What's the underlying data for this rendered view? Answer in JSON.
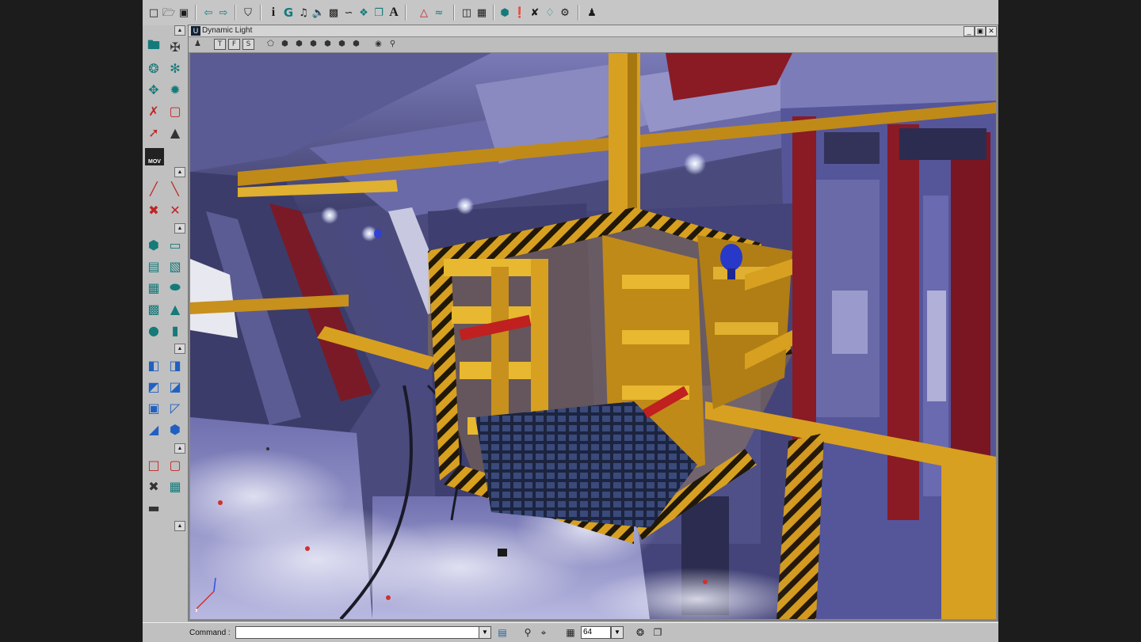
{
  "viewport": {
    "title": "Dynamic Light",
    "view_buttons": [
      "T",
      "F",
      "S"
    ]
  },
  "toolbar_glyphs": {
    "info": "i",
    "text": "A"
  },
  "status_bar": {
    "command_label": "Command :",
    "command_value": "",
    "grid_size": "64"
  },
  "icons": {
    "top": [
      "new-file-icon",
      "open-folder-icon",
      "save-icon",
      "undo-icon",
      "redo-icon",
      "search-icon",
      "info-icon",
      "group-icon",
      "music-icon",
      "sound-icon",
      "texture-icon",
      "mesh-icon",
      "actor-icon",
      "actor-class-icon",
      "text-icon",
      "triangle-icon",
      "terrain-icon",
      "matinee-icon",
      "prefab-icon",
      "light-icon",
      "path-icon",
      "emitter-icon",
      "props-icon",
      "play-level-icon"
    ],
    "left": [
      "camera-mode-icon",
      "move-icon",
      "rotate-icon",
      "scale-icon",
      "brush-move-icon",
      "vertex-icon",
      "clip-icon",
      "polygon-icon",
      "texture-pan-icon",
      "terrain-edit-icon",
      "movie-icon"
    ]
  },
  "colors": {
    "app_chrome": "#c0c0c0",
    "tool_teal": "#157a7a",
    "tool_red": "#c02020",
    "scaffold_yellow": "#d8a020",
    "wall_blue": "#5a5a94",
    "wall_red": "#8a1a24",
    "fog_white": "#dcdcf0"
  }
}
